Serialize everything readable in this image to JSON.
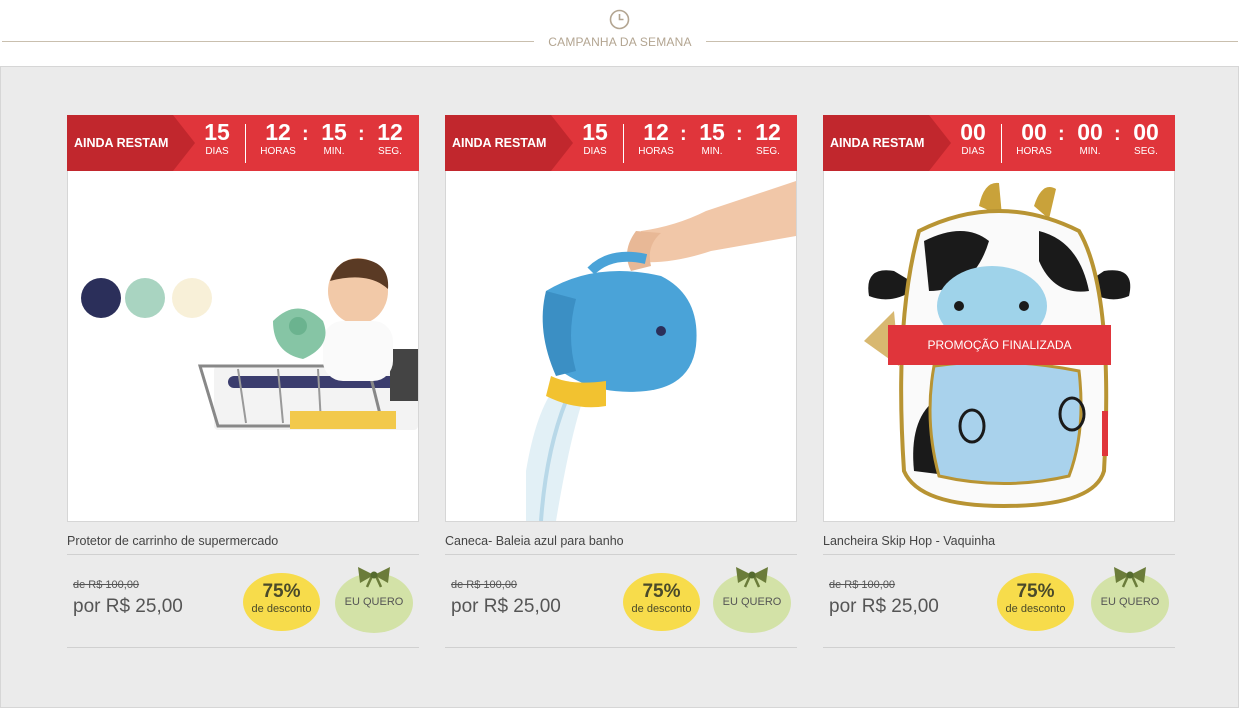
{
  "header": {
    "title": "CAMPANHA DA SEMANA",
    "icon": "clock-icon"
  },
  "colors": {
    "accent_red": "#e0353b",
    "dark_red": "#c1272d",
    "discount_yellow": "#f7dc4b",
    "want_green": "#d3e2a7"
  },
  "cards": [
    {
      "timer": {
        "lead": "AINDA RESTAM",
        "days": "15",
        "hours": "12",
        "minutes": "15",
        "seconds": "12",
        "days_label": "DIAS",
        "hours_label": "HORAS",
        "minutes_label": "MIN.",
        "seconds_label": "SEG."
      },
      "name": "Protetor de carrinho de supermercado",
      "old_price": "de R$ 100,00",
      "new_price": "por R$ 25,00",
      "discount_pct": "75%",
      "discount_label": "de desconto",
      "want_label": "EU QUERO"
    },
    {
      "timer": {
        "lead": "AINDA RESTAM",
        "days": "15",
        "hours": "12",
        "minutes": "15",
        "seconds": "12",
        "days_label": "DIAS",
        "hours_label": "HORAS",
        "minutes_label": "MIN.",
        "seconds_label": "SEG."
      },
      "name": "Caneca- Baleia azul para banho",
      "old_price": "de R$ 100,00",
      "new_price": "por R$ 25,00",
      "discount_pct": "75%",
      "discount_label": "de desconto",
      "want_label": "EU QUERO"
    },
    {
      "timer": {
        "lead": "AINDA RESTAM",
        "days": "00",
        "hours": "00",
        "minutes": "00",
        "seconds": "00",
        "days_label": "DIAS",
        "hours_label": "HORAS",
        "minutes_label": "MIN.",
        "seconds_label": "SEG."
      },
      "name": "Lancheira Skip Hop - Vaquinha",
      "old_price": "de R$ 100,00",
      "new_price": "por R$ 25,00",
      "discount_pct": "75%",
      "discount_label": "de desconto",
      "want_label": "EU QUERO",
      "banner": "PROMOÇÃO FINALIZADA"
    }
  ]
}
